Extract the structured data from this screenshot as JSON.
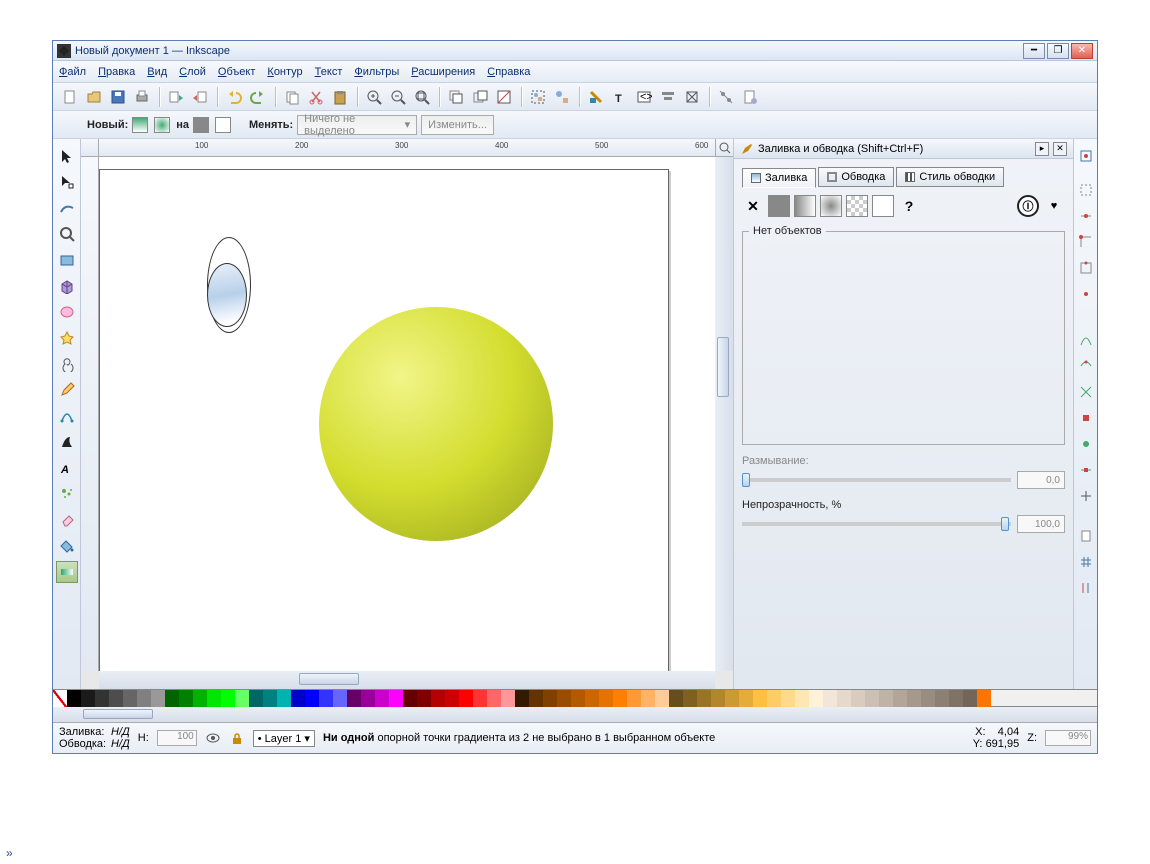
{
  "title": "Новый документ 1 — Inkscape",
  "menu": [
    "Файл",
    "Правка",
    "Вид",
    "Слой",
    "Объект",
    "Контур",
    "Текст",
    "Фильтры",
    "Расширения",
    "Справка"
  ],
  "tb2": {
    "new_label": "Новый:",
    "on_label": "на",
    "change_label": "Менять:",
    "nosel": "Ничего не выделено",
    "edit": "Изменить..."
  },
  "ruler_marks": [
    "100",
    "200",
    "300",
    "400",
    "500",
    "600"
  ],
  "dock": {
    "title": "Заливка и обводка (Shift+Ctrl+F)",
    "tabs": [
      "Заливка",
      "Обводка",
      "Стиль обводки"
    ],
    "fieldset": "Нет объектов",
    "blur_label": "Размывание:",
    "blur_val": "0,0",
    "opacity_label": "Непрозрачность, %",
    "opacity_val": "100,0"
  },
  "palette": [
    "none",
    "#000000",
    "#1a1a1a",
    "#333333",
    "#4d4d4d",
    "#666666",
    "#808080",
    "#999999",
    "#006400",
    "#008000",
    "#00b300",
    "#00e600",
    "#00ff00",
    "#66ff66",
    "#006666",
    "#008080",
    "#00b3b3",
    "#0000cc",
    "#0000ff",
    "#3333ff",
    "#6666ff",
    "#660066",
    "#990099",
    "#cc00cc",
    "#ff00ff",
    "#660000",
    "#800000",
    "#b30000",
    "#cc0000",
    "#ff0000",
    "#ff3333",
    "#ff6666",
    "#ff9999",
    "#331a00",
    "#663300",
    "#804000",
    "#994d00",
    "#b35900",
    "#cc6600",
    "#e67300",
    "#ff8000",
    "#ff9933",
    "#ffb366",
    "#ffcc99",
    "#664d1a",
    "#806020",
    "#997326",
    "#b3862d",
    "#cc9933",
    "#e6ac39",
    "#ffbf40",
    "#ffcc66",
    "#ffd98c",
    "#ffe6b3",
    "#fff2d9",
    "#f2e6d9",
    "#e6d9cc",
    "#d9ccbf",
    "#ccbfb3",
    "#bfb3a6",
    "#b3a699",
    "#a6998c",
    "#998c80",
    "#8c8073",
    "#807366",
    "#736659",
    "#ff7300"
  ],
  "status": {
    "fill_label": "Заливка:",
    "fill_val": "Н/Д",
    "stroke_label": "Обводка:",
    "stroke_val": "Н/Д",
    "h_label": "Н:",
    "h_val": "100",
    "layer": "Layer 1",
    "msg_bold": "Ни одной",
    "msg_rest": " опорной точки градиента из 2 не выбрано в 1 выбранном объекте",
    "x_label": "X:",
    "x_val": "4,04",
    "y_label": "Y:",
    "y_val": "691,95",
    "z_label": "Z:",
    "z_val": "99%"
  }
}
